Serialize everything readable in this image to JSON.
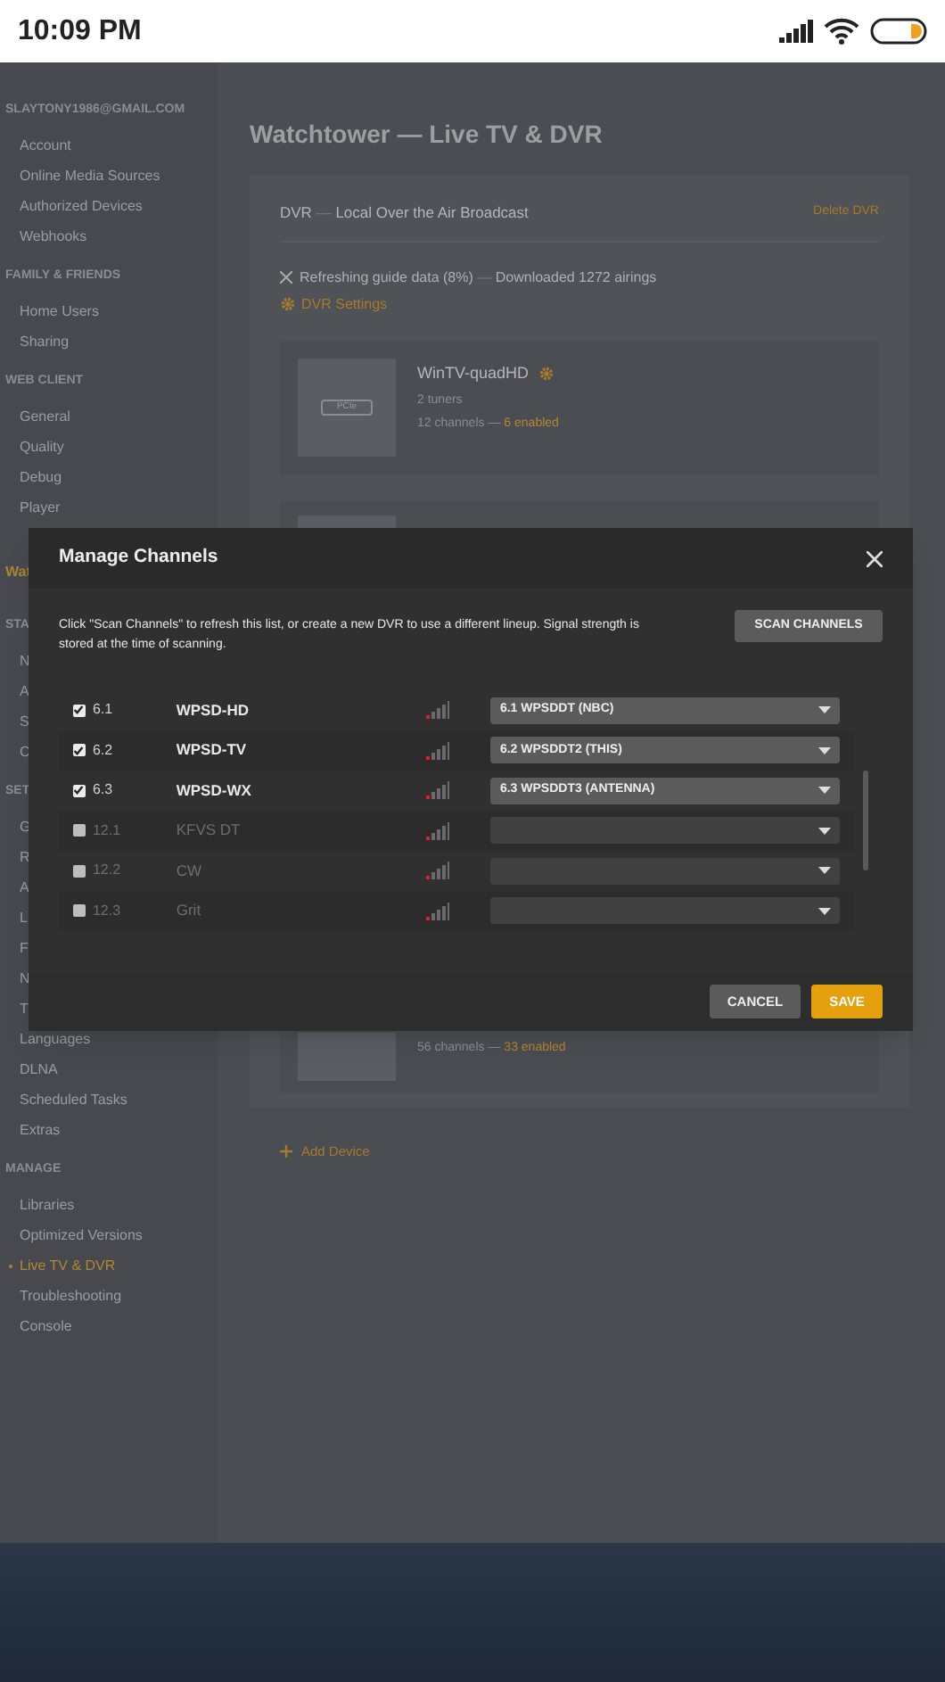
{
  "status_bar": {
    "time": "10:09 PM"
  },
  "sidebar": [
    {
      "kind": "header",
      "label": "SLAYTONY1986@GMAIL.COM"
    },
    {
      "kind": "item",
      "label": "Account",
      "selected": false
    },
    {
      "kind": "item",
      "label": "Online Media Sources",
      "selected": false
    },
    {
      "kind": "item",
      "label": "Authorized Devices",
      "selected": false
    },
    {
      "kind": "item",
      "label": "Webhooks",
      "selected": false
    },
    {
      "kind": "header",
      "label": "FAMILY & FRIENDS"
    },
    {
      "kind": "item",
      "label": "Home Users",
      "selected": false
    },
    {
      "kind": "item",
      "label": "Sharing",
      "selected": false
    },
    {
      "kind": "header",
      "label": "WEB CLIENT"
    },
    {
      "kind": "item",
      "label": "General",
      "selected": false
    },
    {
      "kind": "item",
      "label": "Quality",
      "selected": false
    },
    {
      "kind": "item",
      "label": "Debug",
      "selected": false
    },
    {
      "kind": "item",
      "label": "Player",
      "selected": false
    },
    {
      "kind": "server",
      "label": "Wat"
    },
    {
      "kind": "header",
      "label": "STA"
    },
    {
      "kind": "item",
      "label": "N",
      "selected": false
    },
    {
      "kind": "item",
      "label": "A",
      "selected": false
    },
    {
      "kind": "item",
      "label": "S",
      "selected": false
    },
    {
      "kind": "item",
      "label": "C",
      "selected": false
    },
    {
      "kind": "header",
      "label": "SET"
    },
    {
      "kind": "item",
      "label": "G",
      "selected": false
    },
    {
      "kind": "item",
      "label": "R",
      "selected": false
    },
    {
      "kind": "item",
      "label": "A",
      "selected": false
    },
    {
      "kind": "item",
      "label": "L",
      "selected": false
    },
    {
      "kind": "item",
      "label": "F",
      "selected": false
    },
    {
      "kind": "item",
      "label": "N",
      "selected": false
    },
    {
      "kind": "item",
      "label": "T",
      "selected": false
    },
    {
      "kind": "item",
      "label": "Languages",
      "selected": false
    },
    {
      "kind": "item",
      "label": "DLNA",
      "selected": false
    },
    {
      "kind": "item",
      "label": "Scheduled Tasks",
      "selected": false
    },
    {
      "kind": "item",
      "label": "Extras",
      "selected": false
    },
    {
      "kind": "header",
      "label": "MANAGE"
    },
    {
      "kind": "item",
      "label": "Libraries",
      "selected": false
    },
    {
      "kind": "item",
      "label": "Optimized Versions",
      "selected": false
    },
    {
      "kind": "item",
      "label": "Live TV & DVR",
      "selected": true
    },
    {
      "kind": "item",
      "label": "Troubleshooting",
      "selected": false
    },
    {
      "kind": "item",
      "label": "Console",
      "selected": false
    }
  ],
  "page": {
    "title": "Watchtower — Live TV & DVR",
    "dvr": {
      "label": "DVR",
      "separator": "—",
      "name": "Local Over the Air Broadcast",
      "delete": "Delete DVR",
      "status": "Refreshing guide data (8%)",
      "status_separator": "—",
      "status_detail": "Downloaded 1272 airings",
      "settings": "DVR Settings",
      "devices": [
        {
          "name": "WinTV-quadHD",
          "badge": "PCIe",
          "tuners": "2 tuners",
          "channels": "12 channels",
          "separator": "—",
          "enabled": "6 enabled"
        }
      ],
      "hidden_device": {
        "channels": "56 channels",
        "separator": "—",
        "enabled": "33 enabled"
      }
    },
    "add_device": "Add Device"
  },
  "modal": {
    "title": "Manage Channels",
    "description": "Click \"Scan Channels\" to refresh this list, or create a new DVR to use a different lineup. Signal strength is stored at the time of scanning.",
    "scan_button": "SCAN CHANNELS",
    "channels": [
      {
        "number": "6.1",
        "name": "WPSD-HD",
        "checked": true,
        "mapping": "6.1 WPSDDT (NBC)"
      },
      {
        "number": "6.2",
        "name": "WPSD-TV",
        "checked": true,
        "mapping": "6.2 WPSDDT2 (THIS)"
      },
      {
        "number": "6.3",
        "name": "WPSD-WX",
        "checked": true,
        "mapping": "6.3 WPSDDT3 (ANTENNA)"
      },
      {
        "number": "12.1",
        "name": "KFVS DT",
        "checked": false
      },
      {
        "number": "12.2",
        "name": "CW",
        "checked": false
      },
      {
        "number": "12.3",
        "name": "Grit",
        "checked": false
      }
    ],
    "buttons": [
      {
        "kind": "secondary",
        "label": "CANCEL"
      },
      {
        "kind": "primary",
        "label": "SAVE"
      }
    ]
  }
}
